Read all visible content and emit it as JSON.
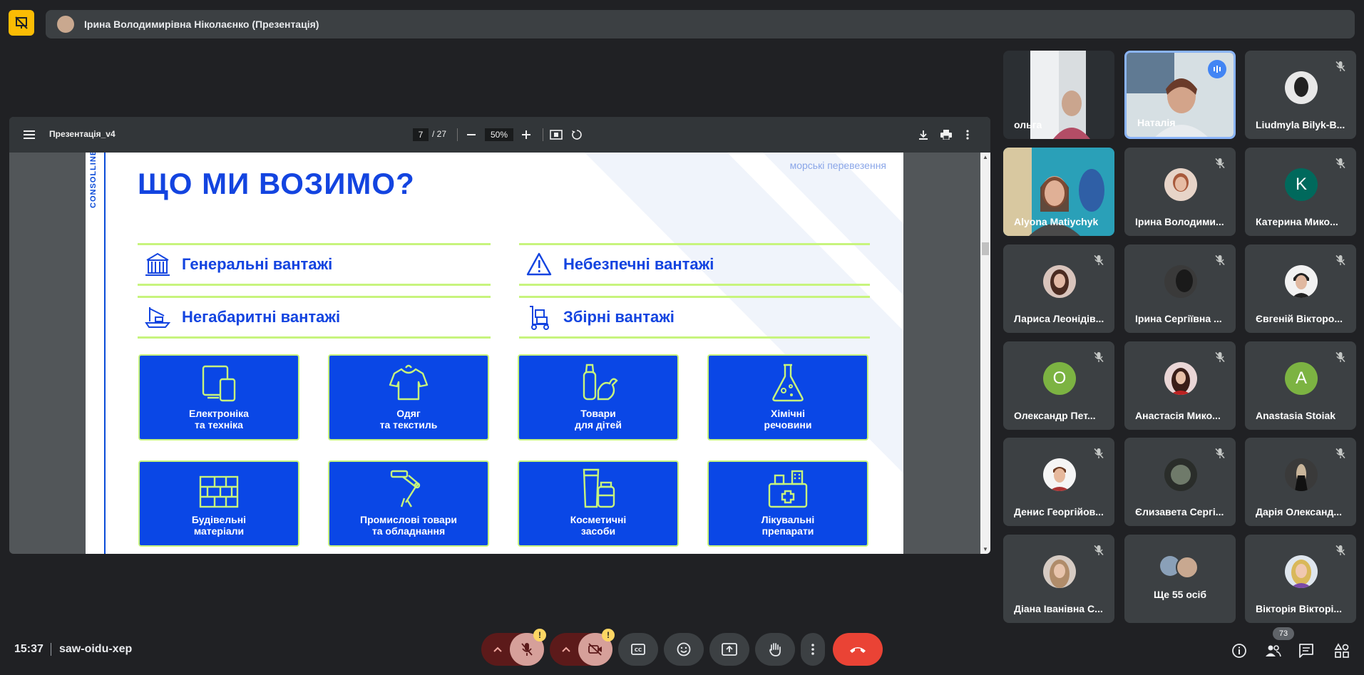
{
  "presenter": {
    "name": "Ірина Володимирівна Ніколаєнко (Презентація)"
  },
  "pdf": {
    "title": "Презентація_v4",
    "page_current": "7",
    "page_total": "/ 27",
    "zoom": "50%"
  },
  "slide": {
    "brand": "CONSOLLINE",
    "tag": "морські перевезення",
    "title": "ЩО МИ ВОЗИМО?",
    "categories": [
      "Генеральні вантажі",
      "Небезпечні вантажі",
      "Негабаритні вантажі",
      "Збірні вантажі"
    ],
    "tiles": [
      {
        "line1": "Електроніка",
        "line2": "та техніка",
        "icon": "devices-icon"
      },
      {
        "line1": "Одяг",
        "line2": "та текстиль",
        "icon": "shirt-icon"
      },
      {
        "line1": "Товари",
        "line2": "для дітей",
        "icon": "baby-bottle-icon"
      },
      {
        "line1": "Хімічні",
        "line2": "речовини",
        "icon": "flask-icon"
      },
      {
        "line1": "Будівельні",
        "line2": "матеріали",
        "icon": "bricks-icon"
      },
      {
        "line1": "Промислові товари",
        "line2": "та обладнання",
        "icon": "robot-arm-icon"
      },
      {
        "line1": "Косметичні",
        "line2": "засоби",
        "icon": "cosmetics-icon"
      },
      {
        "line1": "Лікувальні",
        "line2": "препарати",
        "icon": "medkit-icon"
      }
    ]
  },
  "participants": [
    {
      "name": "ольга"
    },
    {
      "name": "Наталія"
    },
    {
      "name": "Liudmyla Bilyk-B..."
    },
    {
      "name": "Alyona Matiychyk"
    },
    {
      "name": "Ірина Володими..."
    },
    {
      "name": "Катерина Мико...",
      "initial": "K"
    },
    {
      "name": "Лариса Леонідів..."
    },
    {
      "name": "Ірина Сергіївна ..."
    },
    {
      "name": "Євгеній Вікторо..."
    },
    {
      "name": "Олександр Пет...",
      "initial": "О"
    },
    {
      "name": "Анастасія Мико..."
    },
    {
      "name": "Anastasia Stoiak",
      "initial": "A"
    },
    {
      "name": "Денис Георгійов..."
    },
    {
      "name": "Єлизавета Сергі..."
    },
    {
      "name": "Дарія Олександ..."
    },
    {
      "name": "Діана Іванівна С..."
    },
    {
      "name": "Ще 55 осіб"
    },
    {
      "name": "Вікторія Вікторі..."
    }
  ],
  "bottom": {
    "time": "15:37",
    "meeting_code": "saw-oidu-xep",
    "mic_warning": "!",
    "cam_warning": "!",
    "participant_count": "73"
  },
  "colors": {
    "accent_blue": "#1344e0",
    "tile_blue": "#0a47e6",
    "lime": "#c7f47d",
    "end_call_red": "#ea4335",
    "present_yellow": "#fbbc04"
  }
}
